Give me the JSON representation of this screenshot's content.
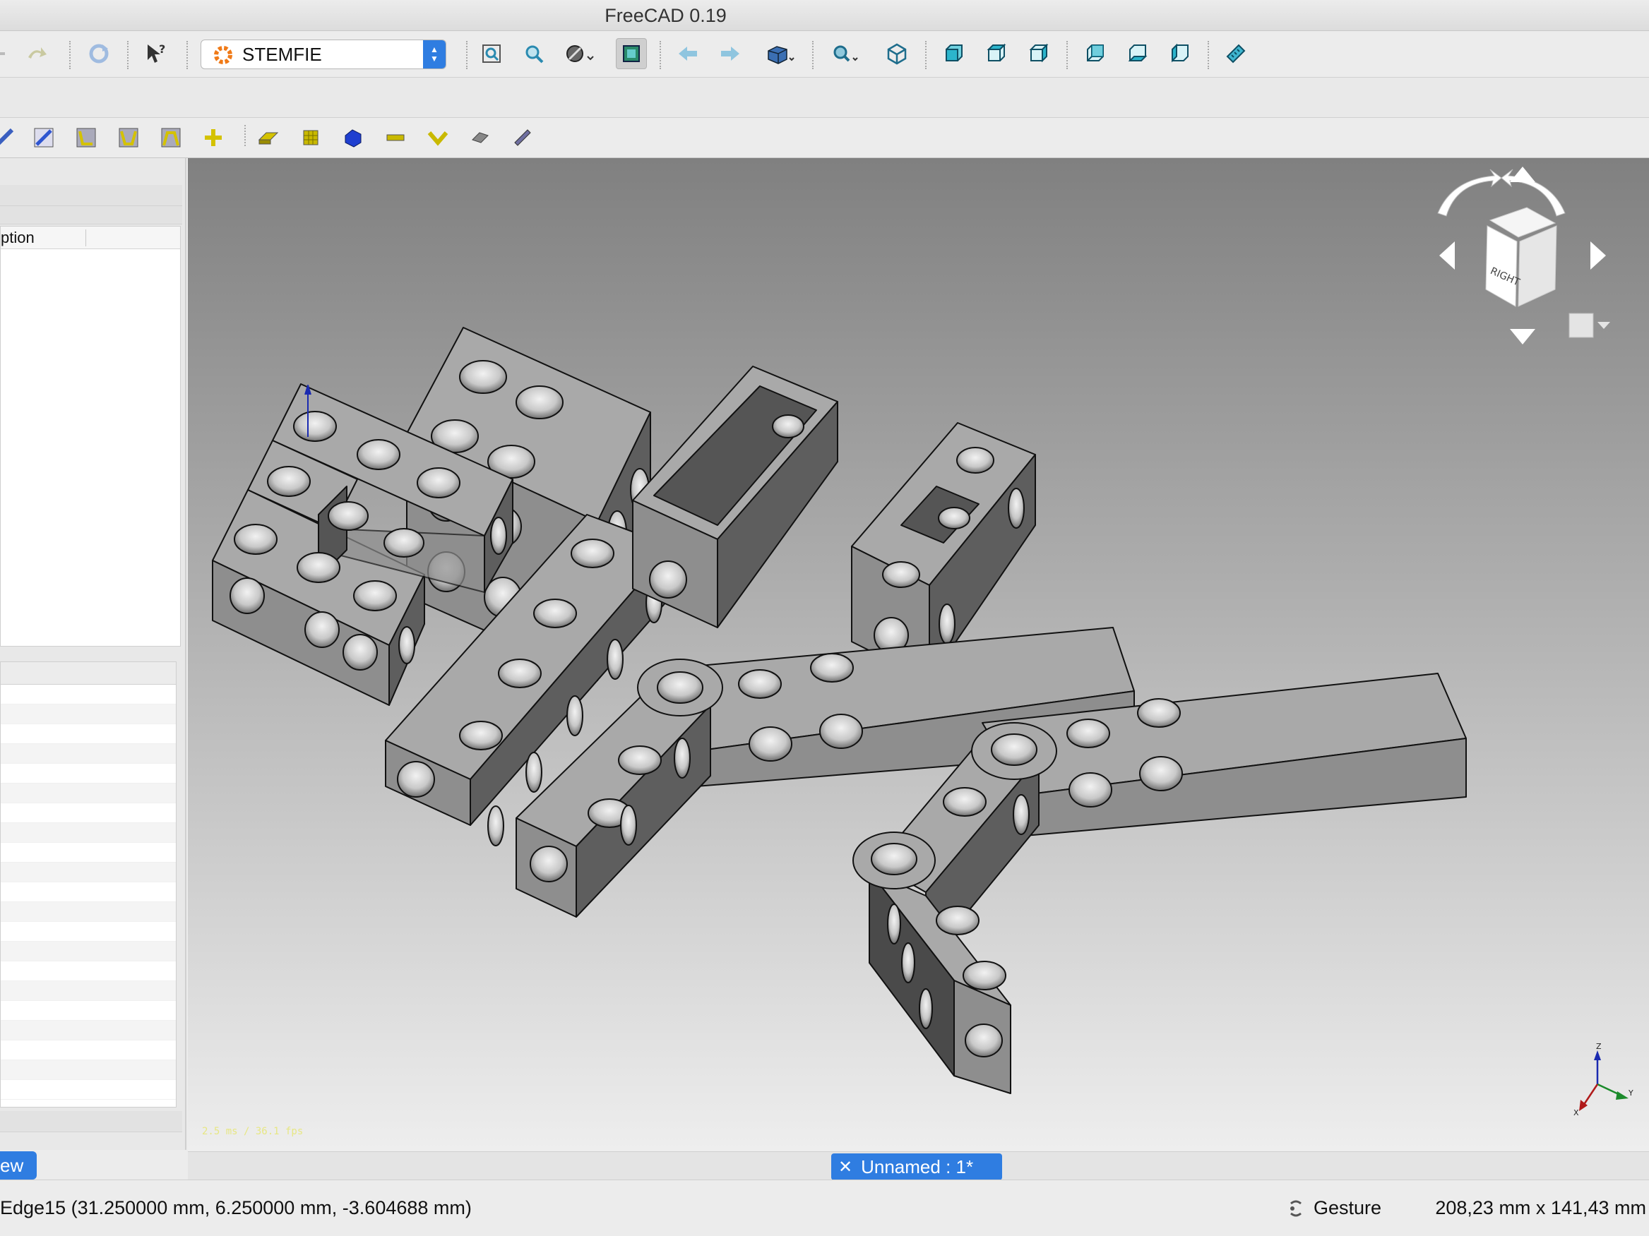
{
  "window": {
    "title": "FreeCAD 0.19"
  },
  "toolbar": {
    "workbench_selector": "STEMFIE"
  },
  "tree_panel": {
    "column_header": "ption"
  },
  "left_panel_tab": "ew",
  "viewport": {
    "fps_overlay": "2.5 ms / 36.1 fps",
    "navcube_face_label": "RIGHT",
    "axis_labels": {
      "x": "X",
      "y": "Y",
      "z": "Z"
    }
  },
  "document_tab": {
    "label": "Unnamed : 1*"
  },
  "statusbar": {
    "message": "Edge15 (31.250000 mm, 6.250000 mm, -3.604688 mm)",
    "navigation_style": "Gesture",
    "dimensions": "208,23 mm x 141,43 mm"
  },
  "colors": {
    "accent": "#2f7de1",
    "part_top": "#a9a9a9",
    "part_left": "#8e8e8e",
    "part_right": "#5e5e5e"
  }
}
